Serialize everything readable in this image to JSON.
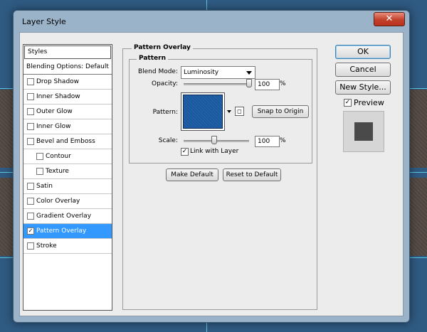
{
  "window": {
    "title": "Layer Style",
    "close_glyph": "✕"
  },
  "styles_list": {
    "header": "Styles",
    "blending_options": "Blending Options: Default",
    "items": [
      {
        "label": "Drop Shadow",
        "checked": false,
        "sub": false,
        "selected": false
      },
      {
        "label": "Inner Shadow",
        "checked": false,
        "sub": false,
        "selected": false
      },
      {
        "label": "Outer Glow",
        "checked": false,
        "sub": false,
        "selected": false
      },
      {
        "label": "Inner Glow",
        "checked": false,
        "sub": false,
        "selected": false
      },
      {
        "label": "Bevel and Emboss",
        "checked": false,
        "sub": false,
        "selected": false
      },
      {
        "label": "Contour",
        "checked": false,
        "sub": true,
        "selected": false
      },
      {
        "label": "Texture",
        "checked": false,
        "sub": true,
        "selected": false
      },
      {
        "label": "Satin",
        "checked": false,
        "sub": false,
        "selected": false
      },
      {
        "label": "Color Overlay",
        "checked": false,
        "sub": false,
        "selected": false
      },
      {
        "label": "Gradient Overlay",
        "checked": false,
        "sub": false,
        "selected": false
      },
      {
        "label": "Pattern Overlay",
        "checked": true,
        "sub": false,
        "selected": true
      },
      {
        "label": "Stroke",
        "checked": false,
        "sub": false,
        "selected": false
      }
    ]
  },
  "pattern_overlay": {
    "group_title": "Pattern Overlay",
    "subgroup_title": "Pattern",
    "blend_mode_label": "Blend Mode:",
    "blend_mode_value": "Luminosity",
    "opacity_label": "Opacity:",
    "opacity_value": "100",
    "opacity_fraction": 1.0,
    "opacity_unit": "%",
    "pattern_label": "Pattern:",
    "pattern_color": "#1d5a9f",
    "snap_to_origin": "Snap to Origin",
    "scale_label": "Scale:",
    "scale_value": "100",
    "scale_fraction": 0.1,
    "scale_unit": "%",
    "link_with_layer_label": "Link with Layer",
    "link_with_layer_checked": true,
    "make_default": "Make Default",
    "reset_to_default": "Reset to Default"
  },
  "right_panel": {
    "ok": "OK",
    "cancel": "Cancel",
    "new_style": "New Style...",
    "preview_label": "Preview",
    "preview_checked": true,
    "check_glyph": "✓"
  },
  "colors": {
    "selection": "#3399ff",
    "background_blue": "#2f5a82",
    "guide_cyan": "#5fc6e2"
  }
}
